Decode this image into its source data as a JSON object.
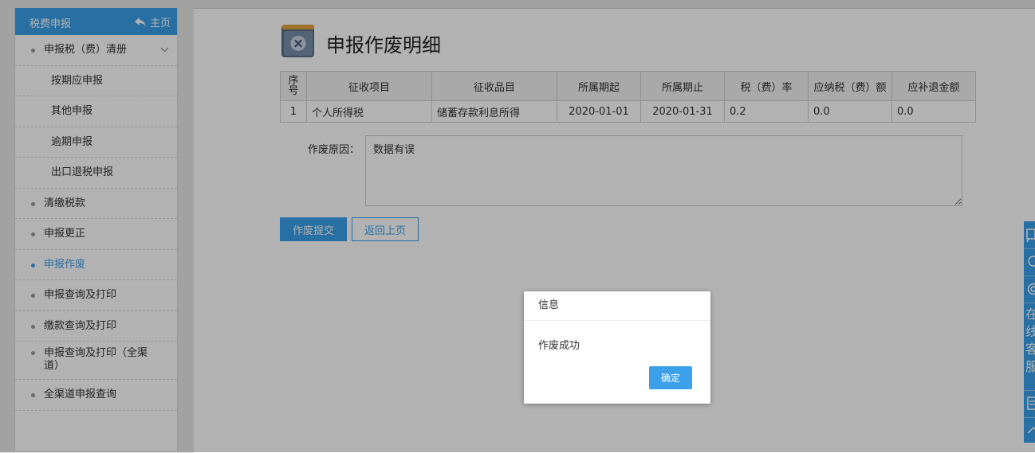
{
  "sidebar": {
    "title": "税费申报",
    "home_label": "主页",
    "items": [
      {
        "label": "申报税（费）清册",
        "type": "parent"
      },
      {
        "label": "按期应申报",
        "type": "sub"
      },
      {
        "label": "其他申报",
        "type": "sub"
      },
      {
        "label": "逾期申报",
        "type": "sub"
      },
      {
        "label": "出口退税申报",
        "type": "sub"
      },
      {
        "label": "清缴税款",
        "type": "item"
      },
      {
        "label": "申报更正",
        "type": "item"
      },
      {
        "label": "申报作废",
        "type": "item",
        "active": true
      },
      {
        "label": "申报查询及打印",
        "type": "item"
      },
      {
        "label": "缴款查询及打印",
        "type": "item"
      },
      {
        "label": "申报查询及打印（全渠道）",
        "type": "item"
      },
      {
        "label": "全渠道申报查询",
        "type": "item"
      }
    ]
  },
  "main": {
    "title": "申报作废明细",
    "table": {
      "headers": [
        "序号",
        "征收项目",
        "征收品目",
        "所属期起",
        "所属期止",
        "税（费）率",
        "应纳税（费）额",
        "应补退金额"
      ],
      "rows": [
        [
          "1",
          "个人所得税",
          "储蓄存款利息所得",
          "2020-01-01",
          "2020-01-31",
          "0.2",
          "0.0",
          "0.0"
        ]
      ]
    },
    "reason_label": "作废原因：",
    "reason_value": "数据有误",
    "submit_label": "作废提交",
    "back_label": "返回上页"
  },
  "float_bar": {
    "online_service_text": "在线客服"
  },
  "dialog": {
    "title": "信息",
    "message": "作废成功",
    "ok_label": "确定"
  },
  "colors": {
    "accent": "#3aa0ea",
    "page_background": "#e9e9e9",
    "overlay": "rgba(0,0,0,0.3)"
  }
}
